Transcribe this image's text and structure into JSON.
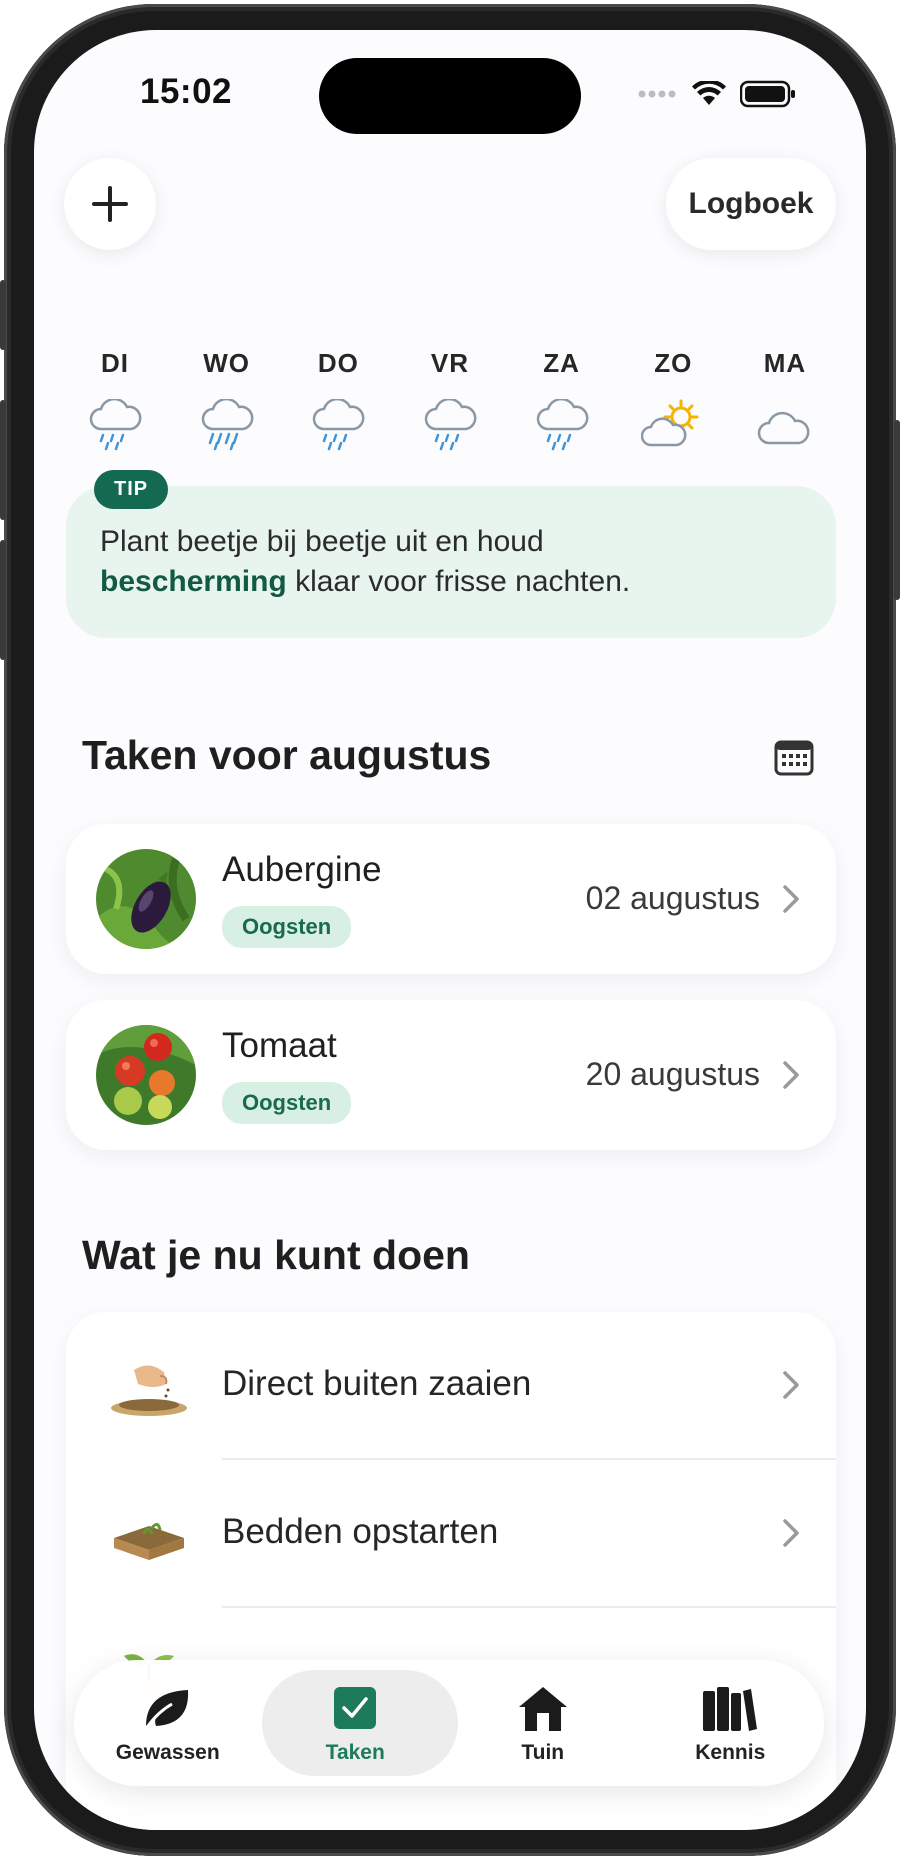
{
  "status_bar": {
    "time": "15:02"
  },
  "header": {
    "add_label": "+",
    "log_label": "Logboek"
  },
  "weather": [
    {
      "day": "DI",
      "icon": "rain-cloud-icon"
    },
    {
      "day": "WO",
      "icon": "heavy-rain-cloud-icon"
    },
    {
      "day": "DO",
      "icon": "rain-cloud-icon"
    },
    {
      "day": "VR",
      "icon": "rain-cloud-icon"
    },
    {
      "day": "ZA",
      "icon": "rain-cloud-icon"
    },
    {
      "day": "ZO",
      "icon": "partly-sunny-icon"
    },
    {
      "day": "MA",
      "icon": "cloud-icon"
    }
  ],
  "tip": {
    "badge": "TIP",
    "text_before": "Plant beetje bij beetje uit en houd",
    "text_strong": "bescherming",
    "text_after": " klaar voor frisse nachten."
  },
  "tasks": {
    "title": "Taken voor augustus",
    "items": [
      {
        "name": "Aubergine",
        "badge": "Oogsten",
        "date": "02 augustus"
      },
      {
        "name": "Tomaat",
        "badge": "Oogsten",
        "date": "20 augustus"
      }
    ]
  },
  "actions": {
    "title": "Wat je nu kunt doen",
    "items": [
      {
        "label": "Direct buiten zaaien"
      },
      {
        "label": "Bedden opstarten"
      }
    ]
  },
  "tabbar": {
    "items": [
      {
        "label": "Gewassen"
      },
      {
        "label": "Taken"
      },
      {
        "label": "Tuin"
      },
      {
        "label": "Kennis"
      }
    ],
    "active": "Taken"
  },
  "colors": {
    "accent": "#136a50",
    "tip_bg": "#e8f4ee",
    "badge_bg": "#d8efe3",
    "active_tab": "#1d7a5a"
  }
}
